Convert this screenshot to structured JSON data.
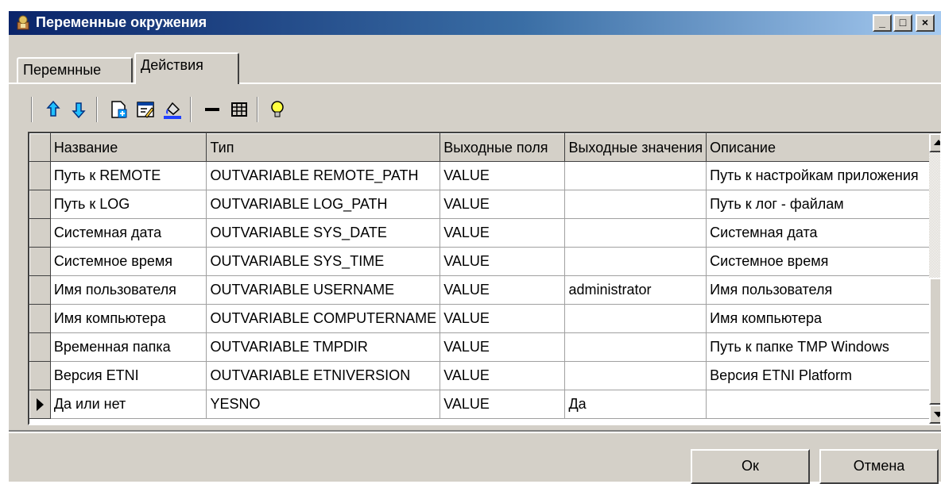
{
  "window": {
    "title": "Переменные окружения",
    "minimize": "_",
    "maximize": "□",
    "close": "×"
  },
  "tabs": [
    {
      "label": "Перемнные",
      "active": false
    },
    {
      "label": "Действия",
      "active": true
    }
  ],
  "toolbar": {
    "icons": [
      "arrow-up-icon",
      "arrow-down-icon",
      "new-document-icon",
      "edit-icon",
      "paint-icon",
      "minus-icon",
      "table-icon",
      "lightbulb-icon"
    ]
  },
  "grid": {
    "columns": [
      "Название",
      "Тип",
      "Выходные поля",
      "Выходные значения",
      "Описание"
    ],
    "rows": [
      [
        "Путь к REMOTE",
        "OUTVARIABLE REMOTE_PATH",
        "VALUE",
        "",
        "Путь к настройкам приложения"
      ],
      [
        "Путь к LOG",
        "OUTVARIABLE LOG_PATH",
        "VALUE",
        "",
        "Путь к лог - файлам"
      ],
      [
        "Системная дата",
        "OUTVARIABLE SYS_DATE",
        "VALUE",
        "",
        "Системная дата"
      ],
      [
        "Системное время",
        "OUTVARIABLE SYS_TIME",
        "VALUE",
        "",
        "Системное время"
      ],
      [
        "Имя пользователя",
        "OUTVARIABLE USERNAME",
        "VALUE",
        "administrator",
        "Имя пользователя"
      ],
      [
        "Имя компьютера",
        "OUTVARIABLE COMPUTERNAME",
        "VALUE",
        "",
        "Имя компьютера"
      ],
      [
        "Временная папка",
        "OUTVARIABLE TMPDIR",
        "VALUE",
        "",
        "Путь к папке TMP Windows"
      ],
      [
        "Версия ETNI",
        "OUTVARIABLE ETNIVERSION",
        "VALUE",
        "",
        "Версия ETNI Platform"
      ],
      [
        "Да или нет",
        "YESNO",
        "VALUE",
        "Да",
        ""
      ]
    ],
    "current_row": 8
  },
  "buttons": {
    "ok": "Ок",
    "cancel": "Отмена"
  }
}
